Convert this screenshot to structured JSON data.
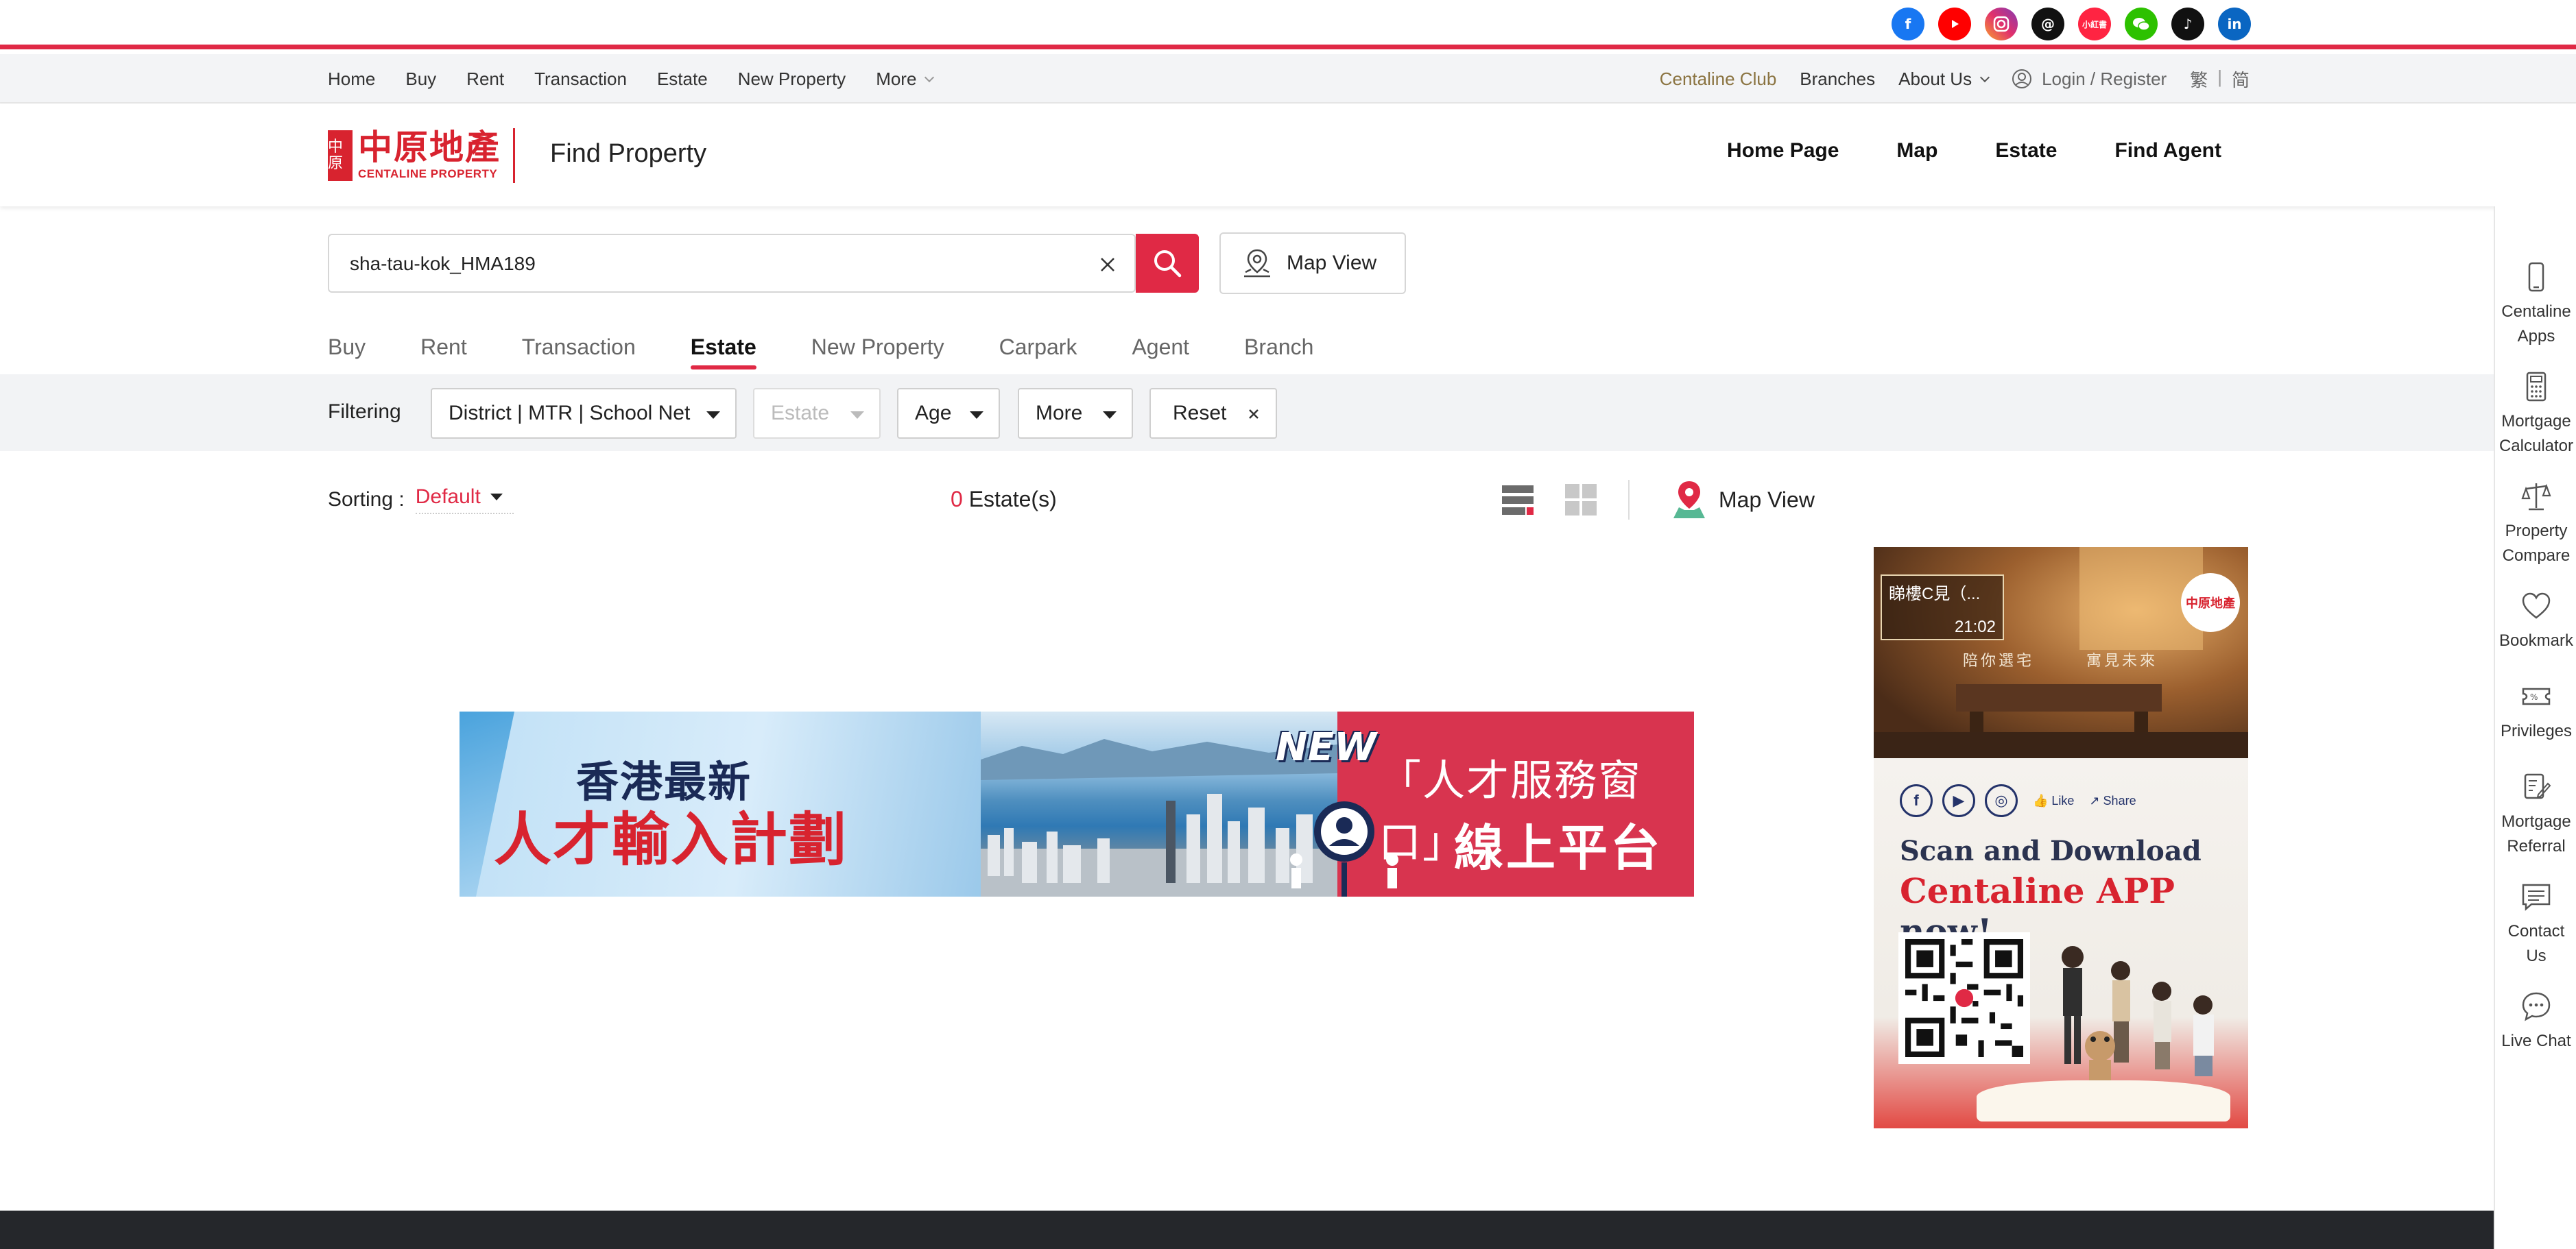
{
  "social": [
    "facebook",
    "youtube",
    "instagram",
    "threads",
    "xiaohongshu",
    "wechat",
    "tiktok",
    "linkedin"
  ],
  "social_labels": {
    "xiaohongshu": "小紅書"
  },
  "top_nav": {
    "items": [
      "Home",
      "Buy",
      "Rent",
      "Transaction",
      "Estate",
      "New Property",
      "More"
    ],
    "club": "Centaline Club",
    "branches": "Branches",
    "about": "About Us",
    "login": "Login / Register",
    "lang_trad": "繁",
    "lang_sep": "|",
    "lang_simp": "简"
  },
  "header": {
    "logo_cn": "中原地產",
    "logo_en": "CENTALINE PROPERTY",
    "logo_seal": "中原",
    "title": "Find Property",
    "nav": [
      "Home Page",
      "Map",
      "Estate",
      "Find Agent"
    ]
  },
  "search": {
    "value": "sha-tau-kok_HMA189",
    "map_view": "Map View"
  },
  "tabs": {
    "items": [
      "Buy",
      "Rent",
      "Transaction",
      "Estate",
      "New Property",
      "Carpark",
      "Agent",
      "Branch"
    ],
    "active": "Estate"
  },
  "filters": {
    "label": "Filtering",
    "district": "District | MTR | School Net",
    "estate": "Estate",
    "age": "Age",
    "more": "More",
    "reset": "Reset"
  },
  "results": {
    "sorting_label": "Sorting :",
    "sorting_value": "Default",
    "count": "0",
    "count_suffix": " Estate(s)",
    "map_view": "Map View"
  },
  "banner": {
    "line1": "香港最新",
    "line2": "人才輸入計劃",
    "new": "NEW",
    "right1": "「人才服務窗口」",
    "right2": "線上平台"
  },
  "side_ad": {
    "video_title": "睇樓C見（...",
    "video_time": "21:02",
    "tag1": "陪你選宅",
    "tag2": "寓見未來",
    "logo": "中原地產",
    "like": "Like",
    "share": "Share",
    "scan": "Scan and Download",
    "app_name": "Centaline APP",
    "app_suffix": " now!"
  },
  "sidebar": [
    {
      "label": "Centaline Apps",
      "icon": "phone-icon"
    },
    {
      "label": "Mortgage Calculator",
      "icon": "calculator-icon"
    },
    {
      "label": "Property Compare",
      "icon": "scale-icon"
    },
    {
      "label": "Bookmark",
      "icon": "heart-icon"
    },
    {
      "label": "Privileges",
      "icon": "ticket-icon"
    },
    {
      "label": "Mortgage Referral",
      "icon": "referral-icon"
    },
    {
      "label": "Contact Us",
      "icon": "message-icon"
    },
    {
      "label": "Live Chat",
      "icon": "chat-icon"
    }
  ],
  "colors": {
    "accent": "#e02945",
    "brand_red": "#d8232f",
    "club_gold": "#8a7340",
    "footer": "#25272b"
  }
}
